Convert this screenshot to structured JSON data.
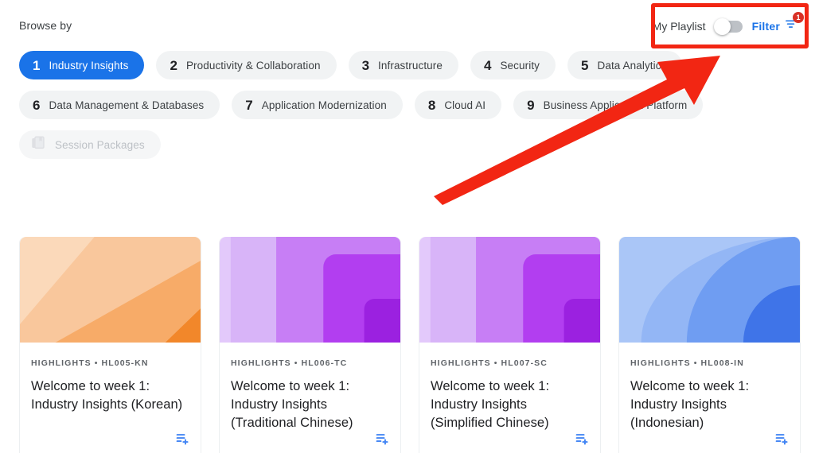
{
  "header": {
    "browse_label": "Browse by",
    "playlist_toggle_label": "My Playlist",
    "playlist_toggle_state": "off",
    "filter_label": "Filter",
    "filter_badge_count": "1",
    "filter_icon": "tune-filter-icon",
    "accent_color": "#1a73e8",
    "badge_color": "#d93025"
  },
  "chips": {
    "row1": [
      {
        "num": "1",
        "label": "Industry Insights",
        "active": true
      },
      {
        "num": "2",
        "label": "Productivity & Collaboration",
        "active": false
      },
      {
        "num": "3",
        "label": "Infrastructure",
        "active": false
      },
      {
        "num": "4",
        "label": "Security",
        "active": false
      },
      {
        "num": "5",
        "label": "Data Analytics",
        "active": false
      }
    ],
    "row2": [
      {
        "num": "6",
        "label": "Data Management & Databases",
        "active": false
      },
      {
        "num": "7",
        "label": "Application Modernization",
        "active": false
      },
      {
        "num": "8",
        "label": "Cloud AI",
        "active": false
      },
      {
        "num": "9",
        "label": "Business Application Platform",
        "active": false
      }
    ],
    "row3": [
      {
        "label": "Session Packages",
        "icon": "session-packages-icon",
        "disabled": true
      }
    ]
  },
  "cards": [
    {
      "meta": "HIGHLIGHTS • HL005-KN",
      "title": "Welcome to week 1: Industry Insights (Korean)",
      "art": "orange-diagonal-stripes",
      "action_icon": "playlist-add-icon"
    },
    {
      "meta": "HIGHLIGHTS • HL006-TC",
      "title": "Welcome to week 1: Industry Insights (Traditional Chinese)",
      "art": "purple-nested-squares",
      "action_icon": "playlist-add-icon"
    },
    {
      "meta": "HIGHLIGHTS • HL007-SC",
      "title": "Welcome to week 1: Industry Insights (Simplified Chinese)",
      "art": "purple-nested-squares",
      "action_icon": "playlist-add-icon"
    },
    {
      "meta": "HIGHLIGHTS • HL008-IN",
      "title": "Welcome to week 1: Industry Insights (Indonesian)",
      "art": "blue-concentric-arcs",
      "action_icon": "playlist-add-icon"
    }
  ],
  "annotation": {
    "highlight_color": "#f22613",
    "arrow": "red-arrow-pointing-to-playlist-controls"
  }
}
